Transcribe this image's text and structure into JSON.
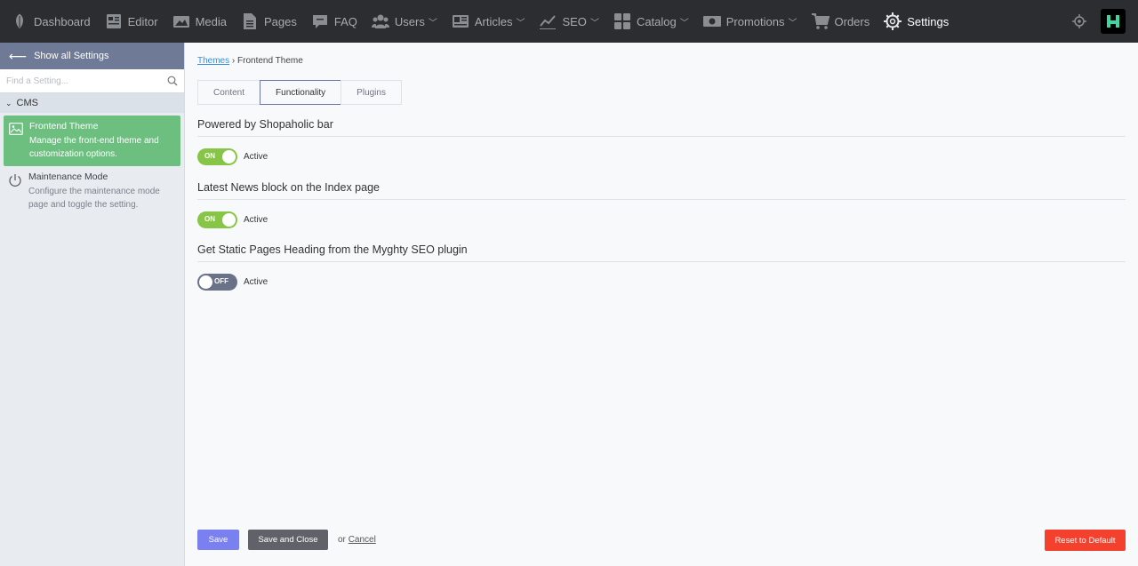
{
  "topnav": {
    "items": [
      {
        "label": "Dashboard",
        "icon": "leaf-icon",
        "dropdown": false
      },
      {
        "label": "Editor",
        "icon": "editor-icon",
        "dropdown": false
      },
      {
        "label": "Media",
        "icon": "image-icon",
        "dropdown": false
      },
      {
        "label": "Pages",
        "icon": "pages-icon",
        "dropdown": false
      },
      {
        "label": "FAQ",
        "icon": "faq-icon",
        "dropdown": false
      },
      {
        "label": "Users",
        "icon": "users-icon",
        "dropdown": true
      },
      {
        "label": "Articles",
        "icon": "newspaper-icon",
        "dropdown": true
      },
      {
        "label": "SEO",
        "icon": "chart-line-icon",
        "dropdown": true
      },
      {
        "label": "Catalog",
        "icon": "grid-icon",
        "dropdown": true
      },
      {
        "label": "Promotions",
        "icon": "money-icon",
        "dropdown": true
      },
      {
        "label": "Orders",
        "icon": "cart-icon",
        "dropdown": false
      },
      {
        "label": "Settings",
        "icon": "gear-icon",
        "dropdown": false,
        "active": true
      }
    ]
  },
  "sidebar": {
    "show_all": "Show all Settings",
    "search_placeholder": "Find a Setting...",
    "group": "CMS",
    "items": [
      {
        "title": "Frontend Theme",
        "desc": "Manage the front-end theme and customization options.",
        "active": true
      },
      {
        "title": "Maintenance Mode",
        "desc": "Configure the maintenance mode page and toggle the setting.",
        "active": false
      }
    ]
  },
  "breadcrumb": {
    "link": "Themes",
    "separator": "›",
    "current": "Frontend Theme"
  },
  "tabs": [
    "Content",
    "Functionality",
    "Plugins"
  ],
  "active_tab": "Functionality",
  "sections": [
    {
      "title": "Powered by Shopaholic bar",
      "state": "ON",
      "label": "Active"
    },
    {
      "title": "Latest News block on the Index page",
      "state": "ON",
      "label": "Active"
    },
    {
      "title": "Get Static Pages Heading from the Myghty SEO plugin",
      "state": "OFF",
      "label": "Active"
    }
  ],
  "footer": {
    "save": "Save",
    "save_close": "Save and Close",
    "or": "or",
    "cancel": "Cancel",
    "reset": "Reset to Default"
  },
  "colors": {
    "topbar": "#2b2d30",
    "sidebar_header": "#6f7a97",
    "active_item": "#6dbf80",
    "toggle_on": "#86c545",
    "toggle_off": "#6a7287",
    "save_button": "#7a80f0",
    "reset_button": "#f4412e"
  }
}
